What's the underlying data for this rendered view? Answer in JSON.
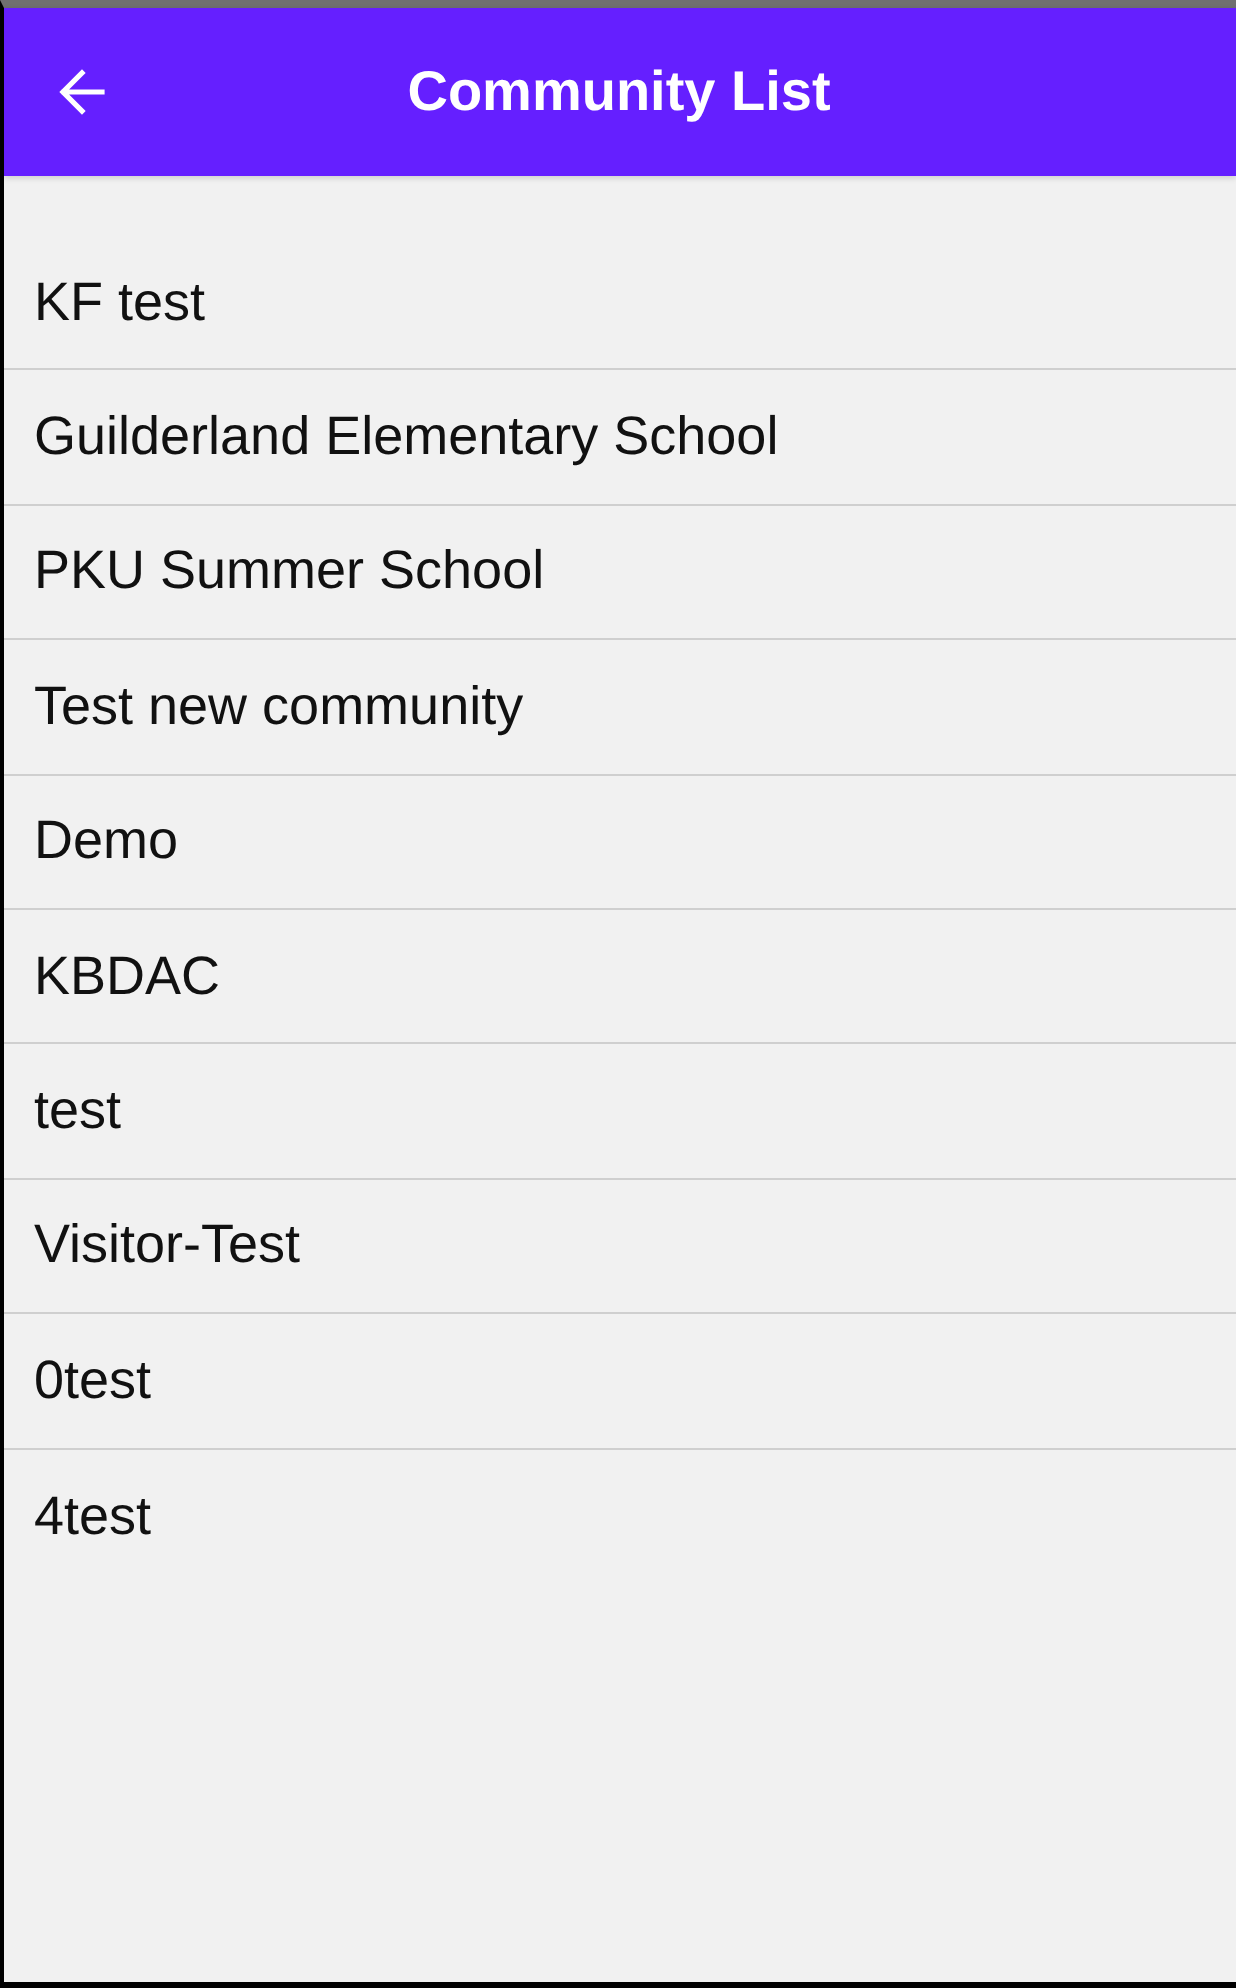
{
  "app_bar": {
    "title": "Community List"
  },
  "communities": [
    {
      "name": "KF test"
    },
    {
      "name": "Guilderland Elementary School"
    },
    {
      "name": "PKU Summer School"
    },
    {
      "name": "Test new community"
    },
    {
      "name": "Demo"
    },
    {
      "name": "KBDAC"
    },
    {
      "name": "test"
    },
    {
      "name": "Visitor-Test"
    },
    {
      "name": "0test"
    },
    {
      "name": "4test"
    }
  ]
}
